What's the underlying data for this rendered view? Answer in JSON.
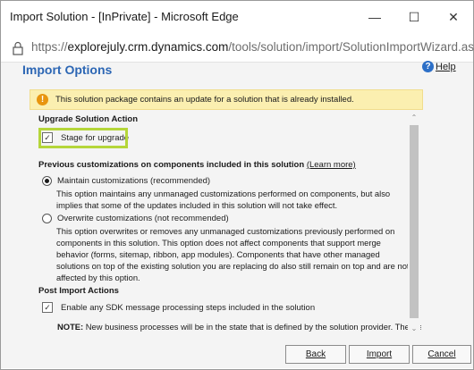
{
  "window": {
    "title": "Import Solution - [InPrivate] - Microsoft Edge",
    "minimize_glyph": "—",
    "maximize_glyph": "☐",
    "close_glyph": "✕"
  },
  "address_bar": {
    "scheme": "https://",
    "host": "explorejuly.crm.dynamics.com",
    "path": "/tools/solution/import/SolutionImportWizard.aspx"
  },
  "page": {
    "title": "Import Options",
    "help_label": "Help",
    "help_icon_glyph": "?"
  },
  "warning": {
    "icon_glyph": "!",
    "text": "This solution package contains an update for a solution that is already installed."
  },
  "upgrade": {
    "heading": "Upgrade Solution Action",
    "stage_label": "Stage for upgrade",
    "stage_checked": true
  },
  "previous": {
    "heading": "Previous customizations on components included in this solution",
    "learn_more": "(Learn more)",
    "options": [
      {
        "label": "Maintain customizations (recommended)",
        "selected": true,
        "description": "This option maintains any unmanaged customizations performed on components, but also implies that some of the updates included in this solution will not take effect."
      },
      {
        "label": "Overwrite customizations (not recommended)",
        "selected": false,
        "description": "This option overwrites or removes any unmanaged customizations previously performed on components in this solution. This option does not affect components that support merge behavior (forms, sitemap, ribbon, app modules). Components that have other managed solutions on top of the existing solution you are replacing do also still remain on top and are not affected by this option."
      }
    ]
  },
  "post_import": {
    "heading": "Post Import Actions",
    "sdk_label": "Enable any SDK message processing steps included in the solution",
    "sdk_checked": true,
    "note_label": "NOTE:",
    "note_text": " New business processes will be in the state that is defined by the solution provider. The state of"
  },
  "scrollbar": {
    "up_glyph": "⌃",
    "down_glyph": "⌄"
  },
  "footer": {
    "back_label": "Back",
    "import_label": "Import",
    "cancel_label": "Cancel"
  },
  "colors": {
    "accent": "#2c66b4",
    "warning_bg": "#fbefb0",
    "highlight": "#b5d63a"
  },
  "check_glyph": "✓"
}
